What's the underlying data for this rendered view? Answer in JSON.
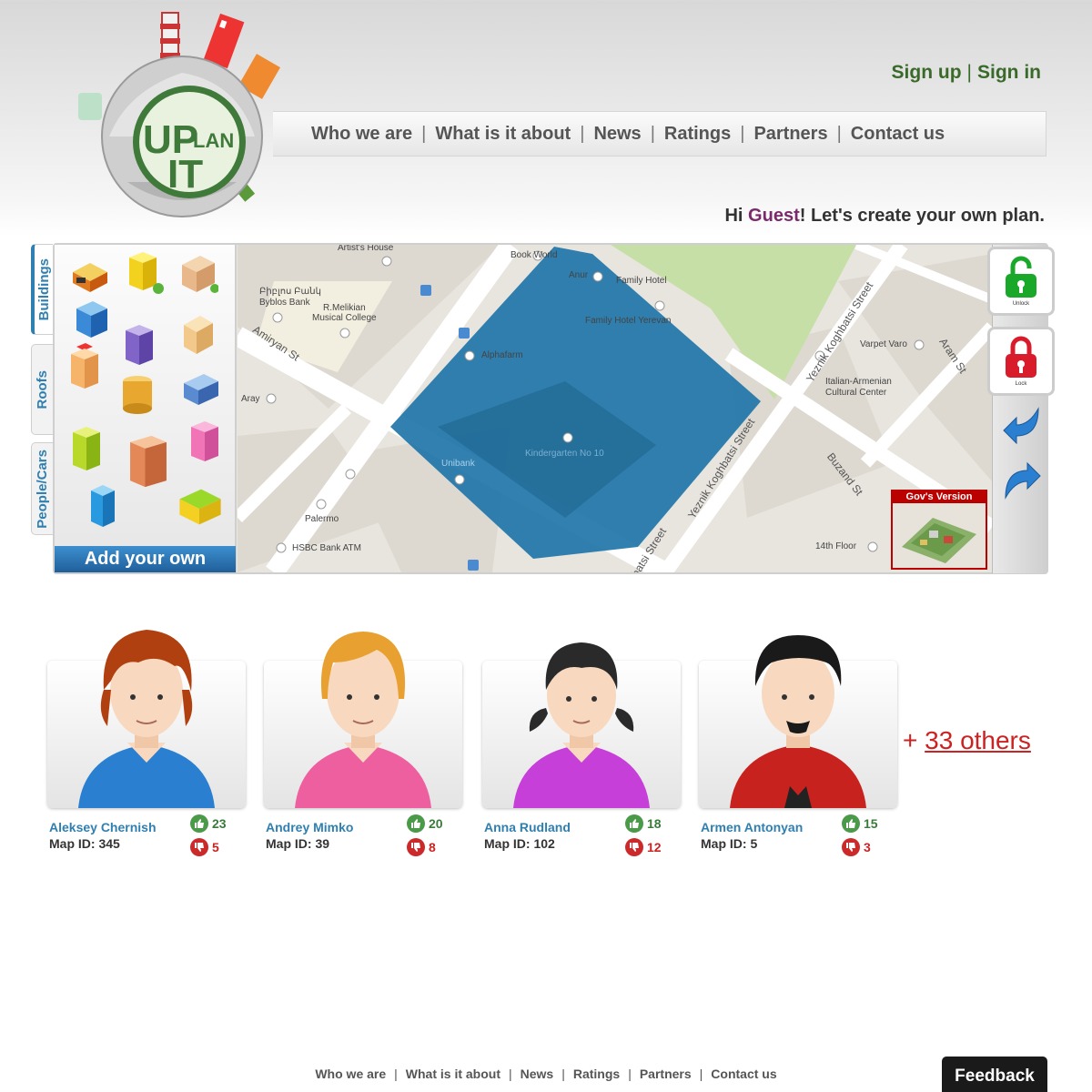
{
  "header": {
    "logo_text_top": "UP",
    "logo_text_mid": "LAN",
    "logo_text_bottom": "IT",
    "auth": {
      "sign_up": "Sign up",
      "separator": "|",
      "sign_in": "Sign in"
    },
    "nav": [
      {
        "label": "Who we are"
      },
      {
        "label": "What is it about"
      },
      {
        "label": "News"
      },
      {
        "label": "Ratings"
      },
      {
        "label": "Partners"
      },
      {
        "label": "Contact us"
      }
    ],
    "nav_separator": "|",
    "greeting": {
      "hi": "Hi ",
      "name": "Guest",
      "rest": "! Let's create your own plan."
    }
  },
  "editor": {
    "tabs": [
      {
        "label": "Buildings",
        "active": true
      },
      {
        "label": "Roofs",
        "active": false
      },
      {
        "label": "People/Cars",
        "active": false
      }
    ],
    "palette_icons": [
      "garage-building-icon",
      "yellow-office-icon",
      "beige-house-icon",
      "blue-tower-icon",
      "purple-tower-icon",
      "tan-apartment-icon",
      "red-roof-tower-icon",
      "round-tower-icon",
      "blue-office-icon",
      "green-tower-icon",
      "brick-skyscraper-icon",
      "pink-tower-icon",
      "cyan-tower-icon",
      "shop-building-icon"
    ],
    "add_your_own": "Add your own",
    "map_labels": {
      "artists_house": "Artist's House",
      "book_world": "Book World",
      "anur": "Anur",
      "family_hotel": "Family Hotel",
      "family_hotel_yerevan": "Family Hotel Yerevan",
      "byblos_arm": "Բիբլոս Բանկ",
      "byblos": "Byblos Bank",
      "melikian": "R.Melikian",
      "musical_college": "Musical College",
      "alphafarm": "Alphafarm",
      "varpet_varo": "Varpet Varo",
      "italian_armenian": "Italian-Armenian",
      "cultural_center": "Cultural Center",
      "aray": "Aray",
      "kindergarten": "Kindergarten No 10",
      "unibank": "Unibank",
      "palermo": "Palermo",
      "hsbc": "HSBC Bank ATM",
      "fourteenth_floor": "14th Floor",
      "amiryan_st": "Amiryan St",
      "yeznik_street": "Yeznik Koghbatsi Street",
      "yeznik_street2": "Yeznik Koghbatsi Street",
      "buzand_st": "Buzand St",
      "aram_st": "Aram St",
      "koghbatsi_street": "batsi Street"
    },
    "gov_version": "Gov's Version",
    "unlock_label": "Unlock",
    "lock_label": "Lock",
    "colors": {
      "plan_area": "#1f75a8",
      "park": "#c6dfa7",
      "accent": "#2f7fb0",
      "lock_green": "#1aa82a",
      "lock_red": "#d81c2c"
    }
  },
  "users": [
    {
      "name": "Aleksey Chernish",
      "map_id": "Map ID: 345",
      "likes": "23",
      "dislikes": "5",
      "hair": "#b04010",
      "shirt": "#2a7fd0",
      "skin": "#f8d9bf"
    },
    {
      "name": "Andrey Mimko",
      "map_id": "Map ID: 39",
      "likes": "20",
      "dislikes": "8",
      "hair": "#e8a030",
      "shirt": "#ee5fa0",
      "skin": "#f8d9bf"
    },
    {
      "name": "Anna Rudland",
      "map_id": "Map ID: 102",
      "likes": "18",
      "dislikes": "12",
      "hair": "#2a2a2a",
      "shirt": "#c63fd8",
      "skin": "#f8d9bf"
    },
    {
      "name": "Armen Antonyan",
      "map_id": "Map ID: 5",
      "likes": "15",
      "dislikes": "3",
      "hair": "#1a1a1a",
      "shirt": "#c8221e",
      "skin": "#f8d9bf"
    }
  ],
  "others": {
    "prefix": "+ ",
    "count_text": "33 others"
  },
  "footer": {
    "links": [
      {
        "label": "Who we are"
      },
      {
        "label": "What is it about"
      },
      {
        "label": "News"
      },
      {
        "label": "Ratings"
      },
      {
        "label": "Partners"
      },
      {
        "label": "Contact us"
      }
    ],
    "separator": "|",
    "feedback": "Feedback"
  }
}
